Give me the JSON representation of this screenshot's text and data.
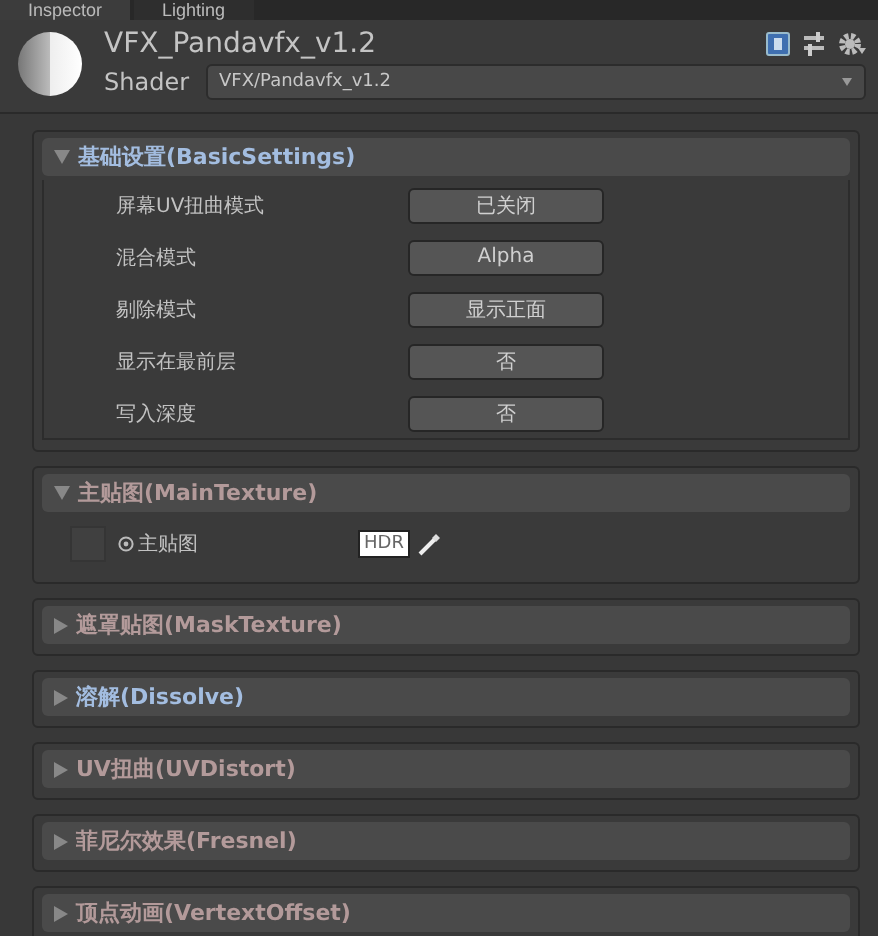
{
  "tabs": [
    {
      "label": "Inspector",
      "selected": true
    },
    {
      "label": "Lighting",
      "selected": false
    }
  ],
  "material": {
    "name": "VFX_Pandavfx_v1.2",
    "shader_label": "Shader",
    "shader": "VFX/Pandavfx_v1.2"
  },
  "sections": [
    {
      "title": "基础设置(BasicSettings)",
      "expanded": true,
      "color": "#a3bde0",
      "rows": [
        {
          "kind": "button",
          "label": "屏幕UV扭曲模式",
          "value": "已关闭"
        },
        {
          "kind": "button",
          "label": "混合模式",
          "value": "Alpha"
        },
        {
          "kind": "button",
          "label": "剔除模式",
          "value": "显示正面"
        },
        {
          "kind": "button",
          "label": "显示在最前层",
          "value": "否"
        },
        {
          "kind": "button",
          "label": "写入深度",
          "value": "否"
        }
      ]
    },
    {
      "title": "主贴图(MainTexture)",
      "expanded": true,
      "color": "#b39a9a",
      "rows": [
        {
          "kind": "texture",
          "label": "主贴图",
          "badge": "HDR"
        }
      ]
    },
    {
      "title": "遮罩贴图(MaskTexture)",
      "expanded": false,
      "color": "#b39a9a"
    },
    {
      "title": "溶解(Dissolve)",
      "expanded": false,
      "color": "#a3bde0"
    },
    {
      "title": "UV扭曲(UVDistort)",
      "expanded": false,
      "color": "#b39a9a"
    },
    {
      "title": "菲尼尔效果(Fresnel)",
      "expanded": false,
      "color": "#b39a9a"
    },
    {
      "title": "顶点动画(VertextOffset)",
      "expanded": false,
      "color": "#b39a9a"
    }
  ]
}
